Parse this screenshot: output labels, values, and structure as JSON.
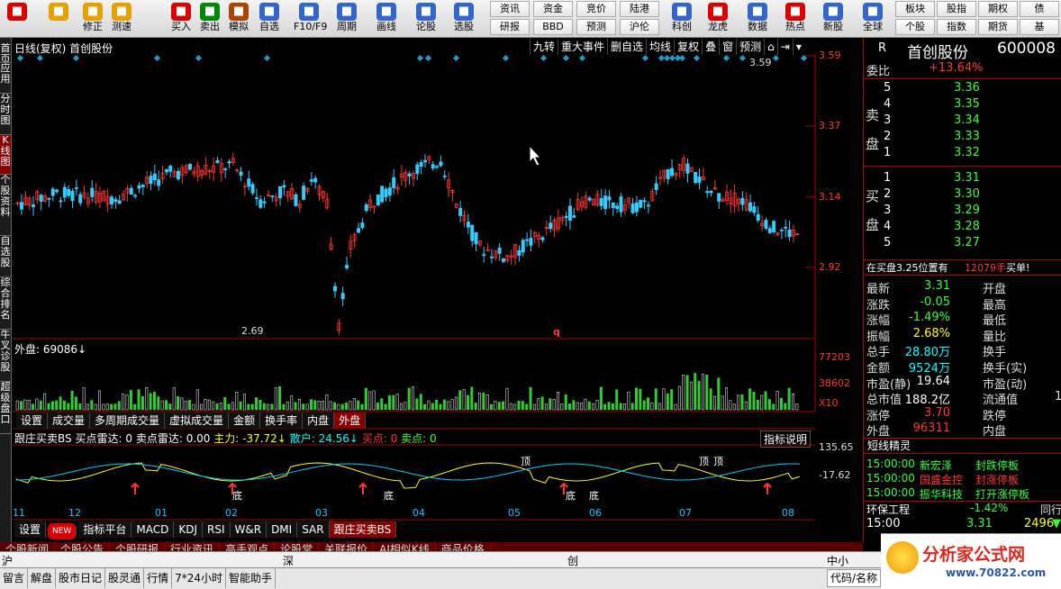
{
  "toolbar": {
    "buttons": [
      {
        "label": "",
        "icon": "windows-logo-icon",
        "color": "#d00"
      },
      {
        "label": "",
        "icon": "back-arrow-icon",
        "color": "#e8a000"
      },
      {
        "label": "修正",
        "icon": "up-down-arrow-icon",
        "color": "#e8a000"
      },
      {
        "label": "测速",
        "icon": "clock-icon",
        "color": "#e8a000"
      },
      {
        "label": "买入",
        "icon": "buy-icon",
        "color": "#d00"
      },
      {
        "label": "卖出",
        "icon": "sell-icon",
        "color": "#080"
      },
      {
        "label": "模拟",
        "icon": "hammer-icon",
        "color": "#a40"
      },
      {
        "label": "自选",
        "icon": "star-icon",
        "color": "#36c"
      },
      {
        "label": "F10/F9",
        "icon": "document-icon",
        "color": "#36c"
      },
      {
        "label": "周期",
        "icon": "clock-period-icon",
        "color": "#36c"
      },
      {
        "label": "画线",
        "icon": "pencil-icon",
        "color": "#36c"
      },
      {
        "label": "论股",
        "icon": "chat-icon",
        "color": "#36c"
      },
      {
        "label": "选股",
        "icon": "filter-icon",
        "color": "#36c"
      }
    ],
    "small_buttons": [
      {
        "label": "资讯"
      },
      {
        "label": "资金"
      },
      {
        "label": "竞价"
      },
      {
        "label": "陆港"
      },
      {
        "label": "研报"
      },
      {
        "label": "BBD"
      },
      {
        "label": "预测"
      },
      {
        "label": "沪伦"
      }
    ],
    "buttons_right": [
      {
        "label": "科创",
        "icon": "chart-icon",
        "color": "#36c"
      },
      {
        "label": "龙虎",
        "icon": "dragon-icon",
        "color": "#d00"
      },
      {
        "label": "数据",
        "icon": "pe-icon",
        "color": "#36c"
      },
      {
        "label": "热点",
        "icon": "hot-icon",
        "color": "#d00"
      },
      {
        "label": "新股",
        "icon": "new-stock-icon",
        "color": "#36c"
      },
      {
        "label": "全球",
        "icon": "globe-icon",
        "color": "#36c"
      }
    ],
    "small_buttons_right": [
      {
        "label": "板块"
      },
      {
        "label": "股指"
      },
      {
        "label": "期权"
      },
      {
        "label": "债"
      },
      {
        "label": "个股"
      },
      {
        "label": "指数"
      },
      {
        "label": "期货"
      },
      {
        "label": "基"
      }
    ]
  },
  "left_tabs": [
    "首页",
    "应用",
    "分时图",
    "K线图",
    "个股资料",
    "自选股",
    "综合排名",
    "牛叉诊股",
    "超级盘口"
  ],
  "kline": {
    "title": "日线(复权) 首创股份",
    "buttons": [
      "九转",
      "重大事件",
      "删自选",
      "均线",
      "复权",
      "叠",
      "窗",
      "预测"
    ],
    "price_ticks": [
      "3.59",
      "3.37",
      "3.14",
      "2.92"
    ],
    "high_label": "3.59",
    "low_label": "2.69",
    "marker": "q"
  },
  "volume": {
    "title": "外盘: 69086↓",
    "ticks": [
      "77203",
      "38602",
      "X10"
    ]
  },
  "sub_tabs": [
    "设置",
    "成交量",
    "多周期成交量",
    "虚拟成交量",
    "金额",
    "换手率",
    "内盘",
    "外盘"
  ],
  "sub_tabs_selected": "外盘",
  "indicator": {
    "name": "跟庄买卖BS",
    "buy_radar_label": "买点雷达:",
    "buy_radar": "0",
    "sell_radar_label": "卖点雷达:",
    "sell_radar": "0.00",
    "main_label": "主力:",
    "main": "-37.72↓",
    "retail_label": "散户:",
    "retail": "24.56↓",
    "buy_point_label": "买点:",
    "buy_point": "0",
    "sell_point_label": "卖点:",
    "sell_point": "0",
    "help": "指标说明",
    "ticks": [
      "135.65",
      "-17.62"
    ],
    "top_label": "顶",
    "bottom_label": "底"
  },
  "months": [
    "11",
    "12",
    "01",
    "02",
    "03",
    "04",
    "05",
    "06",
    "07",
    "08"
  ],
  "ind_tabs": [
    "设置",
    "NEW",
    "指标平台",
    "MACD",
    "KDJ",
    "RSI",
    "W&R",
    "DMI",
    "SAR",
    "跟庄买卖BS"
  ],
  "ind_tabs_selected": "跟庄买卖BS",
  "news_tabs": [
    "个股新闻",
    "个股公告",
    "个股研报",
    "行业资讯",
    "高手观点",
    "论股堂",
    "关联报价",
    "AI相似K线",
    "商品价格"
  ],
  "index_bar": [
    "沪",
    "深",
    "创",
    "中小"
  ],
  "status_bar": [
    "留言",
    "解盘",
    "股市日记",
    "股灵通",
    "行情",
    "7*24小时",
    "智能助手"
  ],
  "search_label": "代码/名称",
  "stock": {
    "badge": "R",
    "name": "首创股份",
    "code": "600008"
  },
  "weibi": {
    "label": "委比",
    "value": "+13.64%"
  },
  "sell_label": "卖盘",
  "buy_label": "买盘",
  "sell_orders": [
    {
      "n": "5",
      "price": "3.36",
      "vol": ""
    },
    {
      "n": "4",
      "price": "3.35",
      "vol": ""
    },
    {
      "n": "3",
      "price": "3.34",
      "vol": ""
    },
    {
      "n": "2",
      "price": "3.33",
      "vol": ""
    },
    {
      "n": "1",
      "price": "3.32",
      "vol": ""
    }
  ],
  "buy_orders": [
    {
      "n": "1",
      "price": "3.31",
      "vol": ""
    },
    {
      "n": "2",
      "price": "3.30",
      "vol": ""
    },
    {
      "n": "3",
      "price": "3.29",
      "vol": ""
    },
    {
      "n": "4",
      "price": "3.28",
      "vol": ""
    },
    {
      "n": "5",
      "price": "3.27",
      "vol": ""
    }
  ],
  "order_note": {
    "text": "在买盘3.25位置有",
    "vol": "12079手",
    "act": "买单!"
  },
  "quote": [
    {
      "k": "最新",
      "v": "3.31",
      "k2": "开盘",
      "v2": ""
    },
    {
      "k": "涨跌",
      "v": "-0.05",
      "k2": "最高",
      "v2": ""
    },
    {
      "k": "涨幅",
      "v": "-1.49%",
      "k2": "最低",
      "v2": ""
    },
    {
      "k": "振幅",
      "v": "2.68%",
      "k2": "量比",
      "v2": ""
    },
    {
      "k": "总手",
      "v": "28.80万",
      "k2": "换手",
      "v2": ""
    },
    {
      "k": "金额",
      "v": "9524万",
      "k2": "换手(实)",
      "v2": ""
    },
    {
      "k": "市盈(静)",
      "v": "19.64",
      "k2": "市盈(动)",
      "v2": ""
    },
    {
      "k": "总市值",
      "v": "188.2亿",
      "k2": "流通值",
      "v2": "1"
    },
    {
      "k": "涨停",
      "v": "3.70",
      "k2": "跌停",
      "v2": ""
    },
    {
      "k": "外盘",
      "v": "96311",
      "k2": "内盘",
      "v2": ""
    }
  ],
  "short_title": "短线精灵",
  "short_list": [
    {
      "time": "15:00:00",
      "name": "新宏泽",
      "event": "封跌停板"
    },
    {
      "time": "15:00:00",
      "name": "国盛金控",
      "event": "封涨停板"
    },
    {
      "time": "15:00:00",
      "name": "振华科技",
      "event": "打开涨停板"
    }
  ],
  "tick_panel": {
    "name": "环保工程",
    "change": "-1.42%",
    "tag": "同行",
    "time": "15:00",
    "price": "3.31",
    "vol": "2496"
  },
  "logo": {
    "text": "分析家公式网",
    "url": "www.70822.com"
  },
  "colors": {
    "up": "#ff3333",
    "down": "#33ccff",
    "accent": "#cc0000"
  }
}
